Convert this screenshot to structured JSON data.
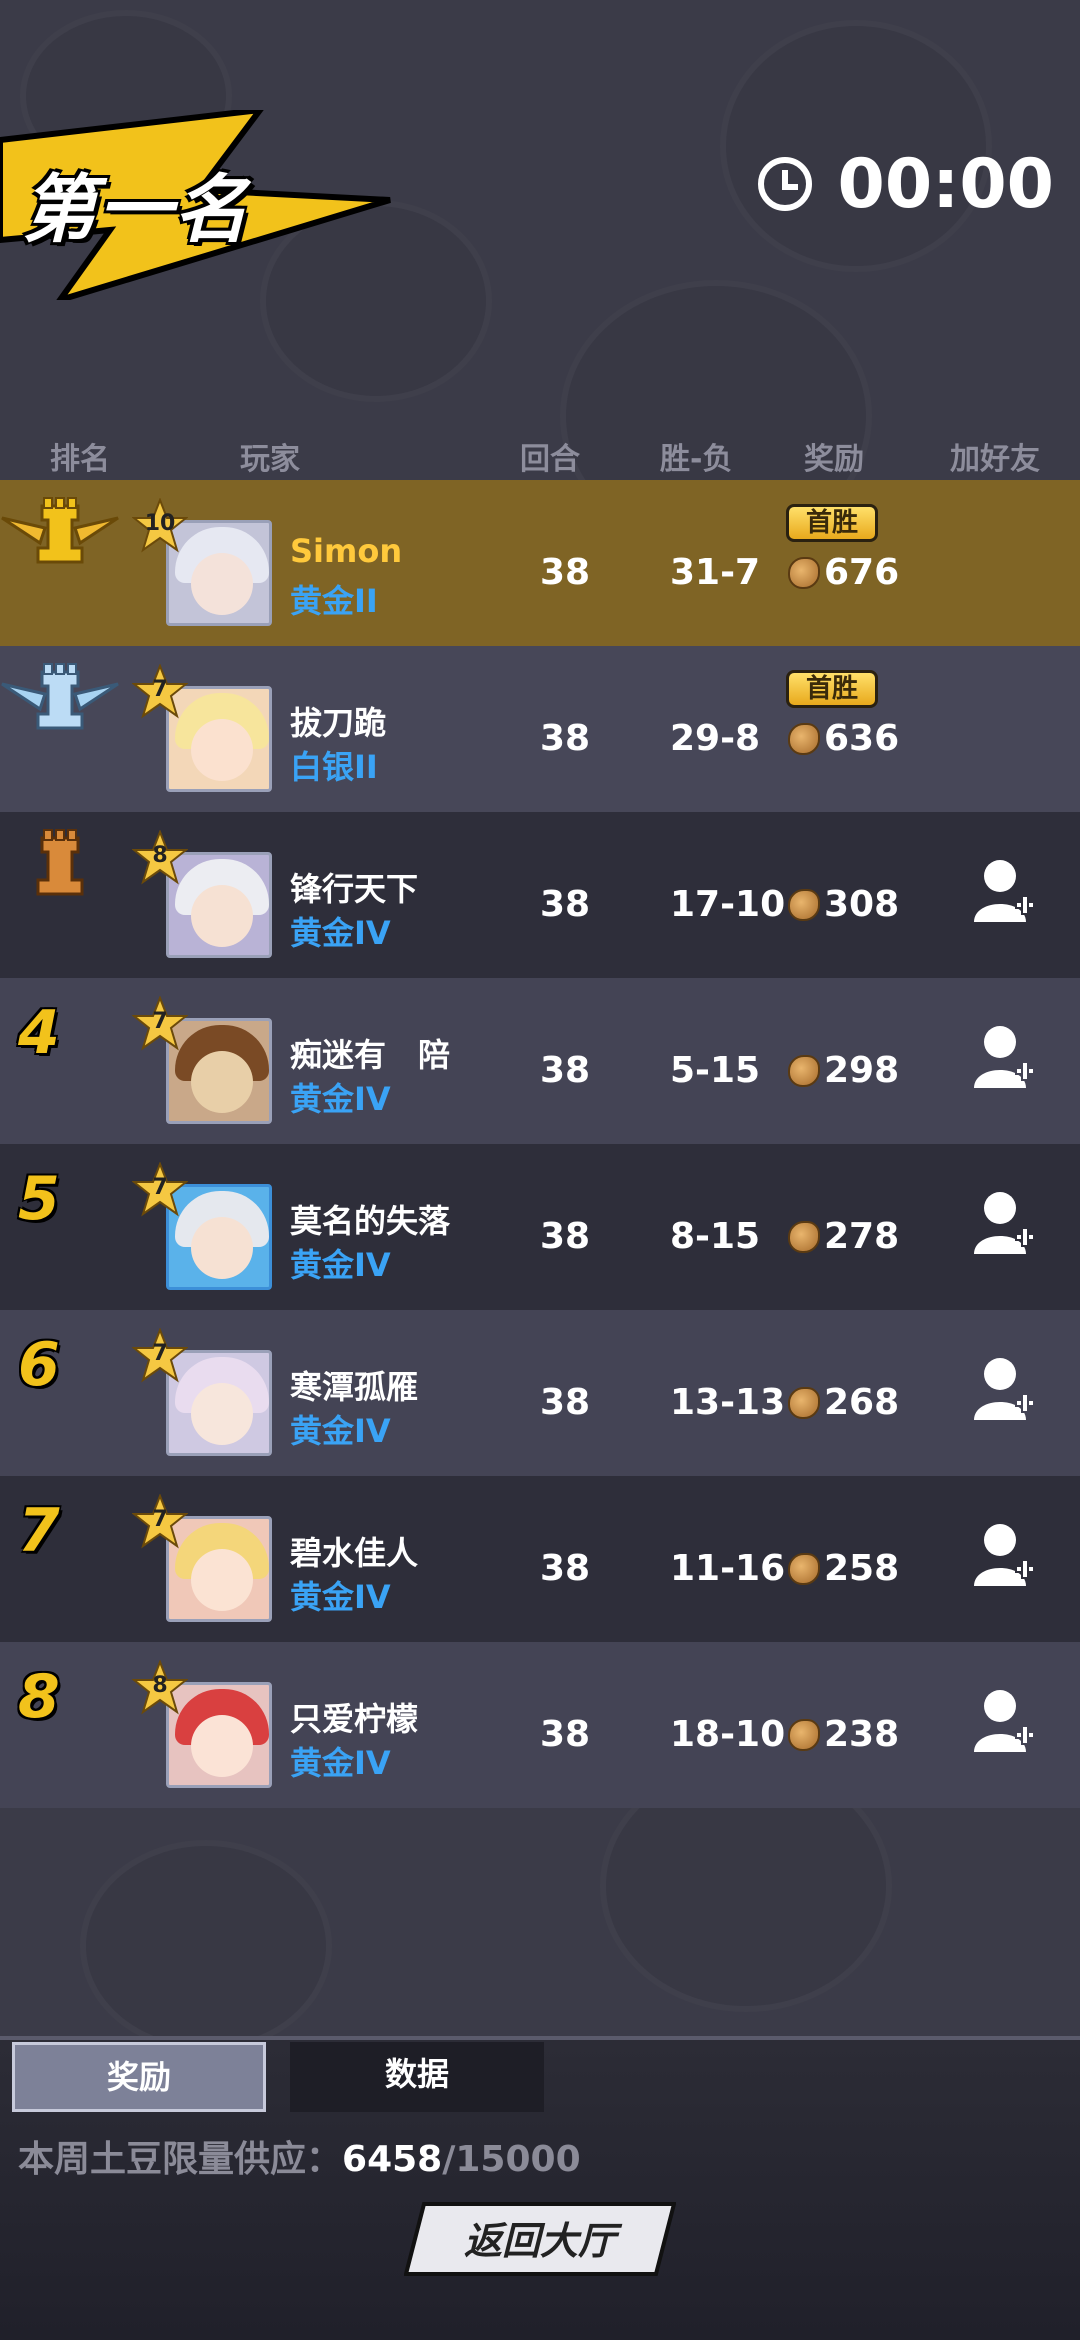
{
  "title": "第一名",
  "timer": "00:00",
  "header": {
    "rank": "排名",
    "player": "玩家",
    "rounds": "回合",
    "win_loss": "胜-负",
    "reward": "奖励",
    "add_friend": "加好友"
  },
  "first_win_label": "首胜",
  "rows": [
    {
      "rank": "1",
      "level": "10",
      "name": "Simon",
      "tier": "黄金II",
      "rounds": "38",
      "wl": "31-7",
      "reward": "676"
    },
    {
      "rank": "2",
      "level": "7",
      "name": "拔刀跪",
      "tier": "白银II",
      "rounds": "38",
      "wl": "29-8",
      "reward": "636"
    },
    {
      "rank": "3",
      "level": "8",
      "name": "锋行天下",
      "tier": "黄金IV",
      "rounds": "38",
      "wl": "17-10",
      "reward": "308"
    },
    {
      "rank": "4",
      "level": "7",
      "name": "痴迷有　陪",
      "tier": "黄金IV",
      "rounds": "38",
      "wl": "5-15",
      "reward": "298"
    },
    {
      "rank": "5",
      "level": "7",
      "name": "莫名的失落",
      "tier": "黄金IV",
      "rounds": "38",
      "wl": "8-15",
      "reward": "278"
    },
    {
      "rank": "6",
      "level": "7",
      "name": "寒潭孤雁",
      "tier": "黄金IV",
      "rounds": "38",
      "wl": "13-13",
      "reward": "268"
    },
    {
      "rank": "7",
      "level": "7",
      "name": "碧水佳人",
      "tier": "黄金IV",
      "rounds": "38",
      "wl": "11-16",
      "reward": "258"
    },
    {
      "rank": "8",
      "level": "8",
      "name": "只爱柠檬",
      "tier": "黄金IV",
      "rounds": "38",
      "wl": "18-10",
      "reward": "238"
    }
  ],
  "tabs": {
    "reward": "奖励",
    "data": "数据"
  },
  "supply": {
    "label": "本周土豆限量供应：",
    "current": "6458",
    "max": "/15000"
  },
  "return_button": "返回大厅",
  "colors": {
    "gold_row": "#7f6425",
    "rank_number": "#f2c21b",
    "tier_blue": "#3aa3f5",
    "name_first": "#ffc93c"
  }
}
